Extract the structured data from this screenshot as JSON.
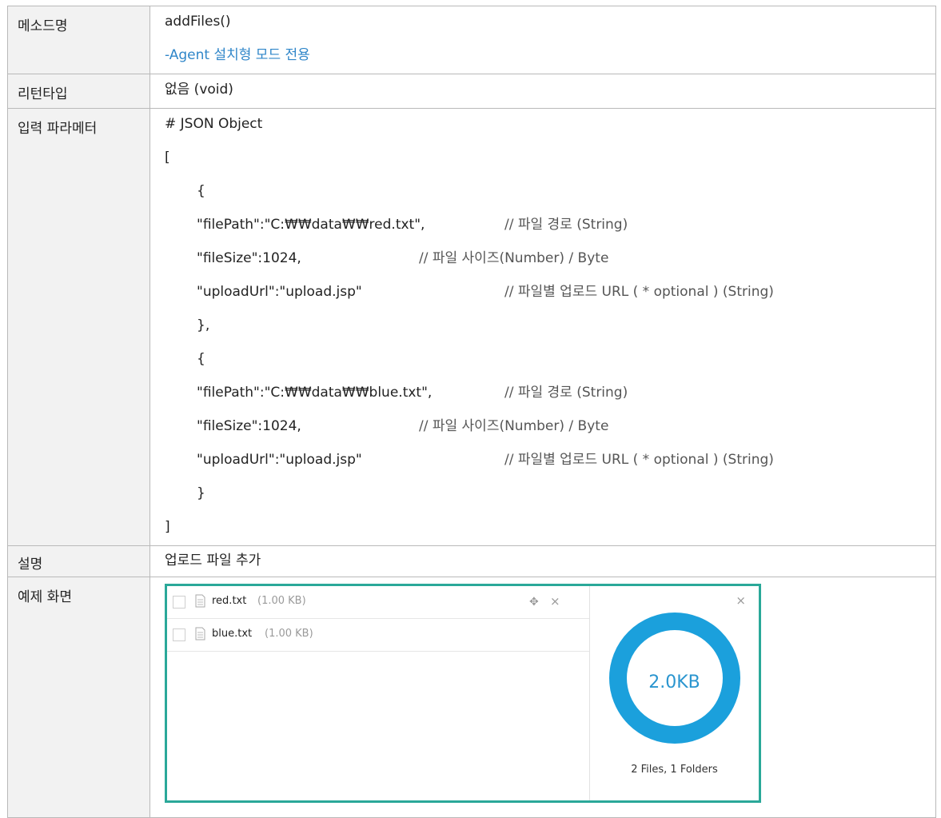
{
  "rows": {
    "method": {
      "label": "메소드명",
      "name": "addFiles()",
      "note": "-Agent 설치형 모드 전용"
    },
    "return": {
      "label": "리턴타입",
      "value": "없음 (void)"
    },
    "params": {
      "label": "입력 파라메터",
      "heading": "# JSON Object",
      "open_bracket": "[",
      "close_bracket": "]",
      "items": [
        {
          "open": "{",
          "close": "},",
          "lines": [
            {
              "code": "\"filePath\":\"C:₩₩data₩₩red.txt\",",
              "comment": "// 파일 경로 (String)"
            },
            {
              "code": "\"fileSize\":1024,",
              "comment": "// 파일 사이즈(Number) / Byte"
            },
            {
              "code": "\"uploadUrl\":\"upload.jsp\"",
              "comment": "// 파일별 업로드 URL ( * optional ) (String)"
            }
          ]
        },
        {
          "open": "{",
          "close": "}",
          "lines": [
            {
              "code": "\"filePath\":\"C:₩₩data₩₩blue.txt\",",
              "comment": "// 파일 경로 (String)"
            },
            {
              "code": "\"fileSize\":1024,",
              "comment": "// 파일 사이즈(Number) / Byte"
            },
            {
              "code": "\"uploadUrl\":\"upload.jsp\"",
              "comment": "// 파일별 업로드 URL ( * optional ) (String)"
            }
          ]
        }
      ]
    },
    "description": {
      "label": "설명",
      "value": "업로드 파일 추가"
    },
    "example": {
      "label": "예제 화면",
      "files": [
        {
          "name": "red.txt",
          "size": "(1.00 KB)"
        },
        {
          "name": "blue.txt",
          "size": "(1.00 KB)"
        }
      ],
      "total_size": "2.0KB",
      "counts": "2 Files, 1 Folders",
      "ring_color": "#1ba0dc",
      "border_color": "#2aa899",
      "icons": {
        "move": "move-icon",
        "delete": "close-icon",
        "file": "document-icon"
      }
    }
  }
}
